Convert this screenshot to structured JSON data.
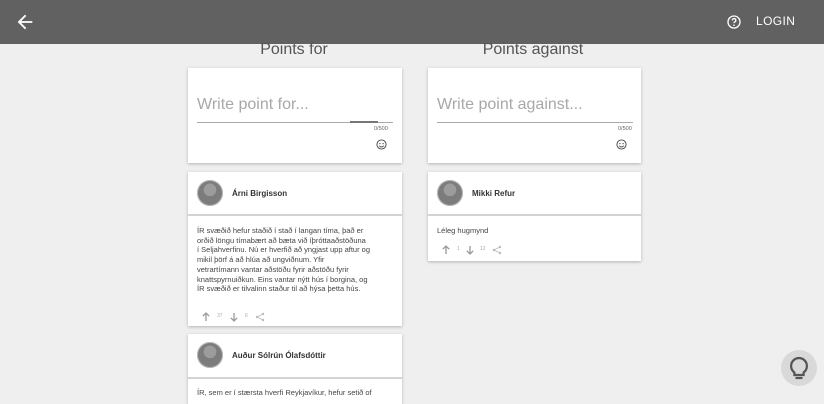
{
  "header": {
    "back_icon": "arrow-left-icon",
    "help_icon": "help-circle-icon",
    "login_label": "LOGIN"
  },
  "columns": [
    {
      "title": "Points for",
      "compose": {
        "placeholder": "Write point for...",
        "counter": "0/500",
        "emoji_icon": "smiley-icon"
      },
      "points": [
        {
          "author": "Árni Birgisson",
          "lines": [
            "ÍR svæðið hefur staðið í stað í langan tíma, það er",
            "orðið löngu tímabært að bæta við íþróttaaðstöðuna",
            "í Seljahverfinu. Nú er hverfið að yngjast upp aftur og",
            "mikil þörf á að hlúa að ungviðnum. Yfir",
            "vetrartímann vantar aðstöðu fyrir aðstöðu fyrir",
            "knattspyrnuiðkun. Eins vantar nýtt hús í borgina, og",
            "ÍR svæðið er tilvalinn staður til að hýsa þetta hús."
          ],
          "upvotes": "37",
          "downvotes": "6"
        },
        {
          "author": "Auður Sólrún Ólafsdóttir",
          "lines": [
            "ÍR, sem er í stærsta hverfi Reykjavíkur, hefur setið of"
          ]
        }
      ]
    },
    {
      "title": "Points against",
      "compose": {
        "placeholder": "Write point against...",
        "counter": "0/500",
        "emoji_icon": "smiley-icon"
      },
      "points": [
        {
          "author": "Mikki Refur",
          "lines": [
            "Léleg hugmynd"
          ],
          "upvotes": "1",
          "downvotes": "12"
        }
      ]
    }
  ],
  "fab": {
    "icon": "lightbulb-icon"
  },
  "colors": {
    "appbar": "#616161",
    "background": "#efefef",
    "card": "#ffffff"
  }
}
